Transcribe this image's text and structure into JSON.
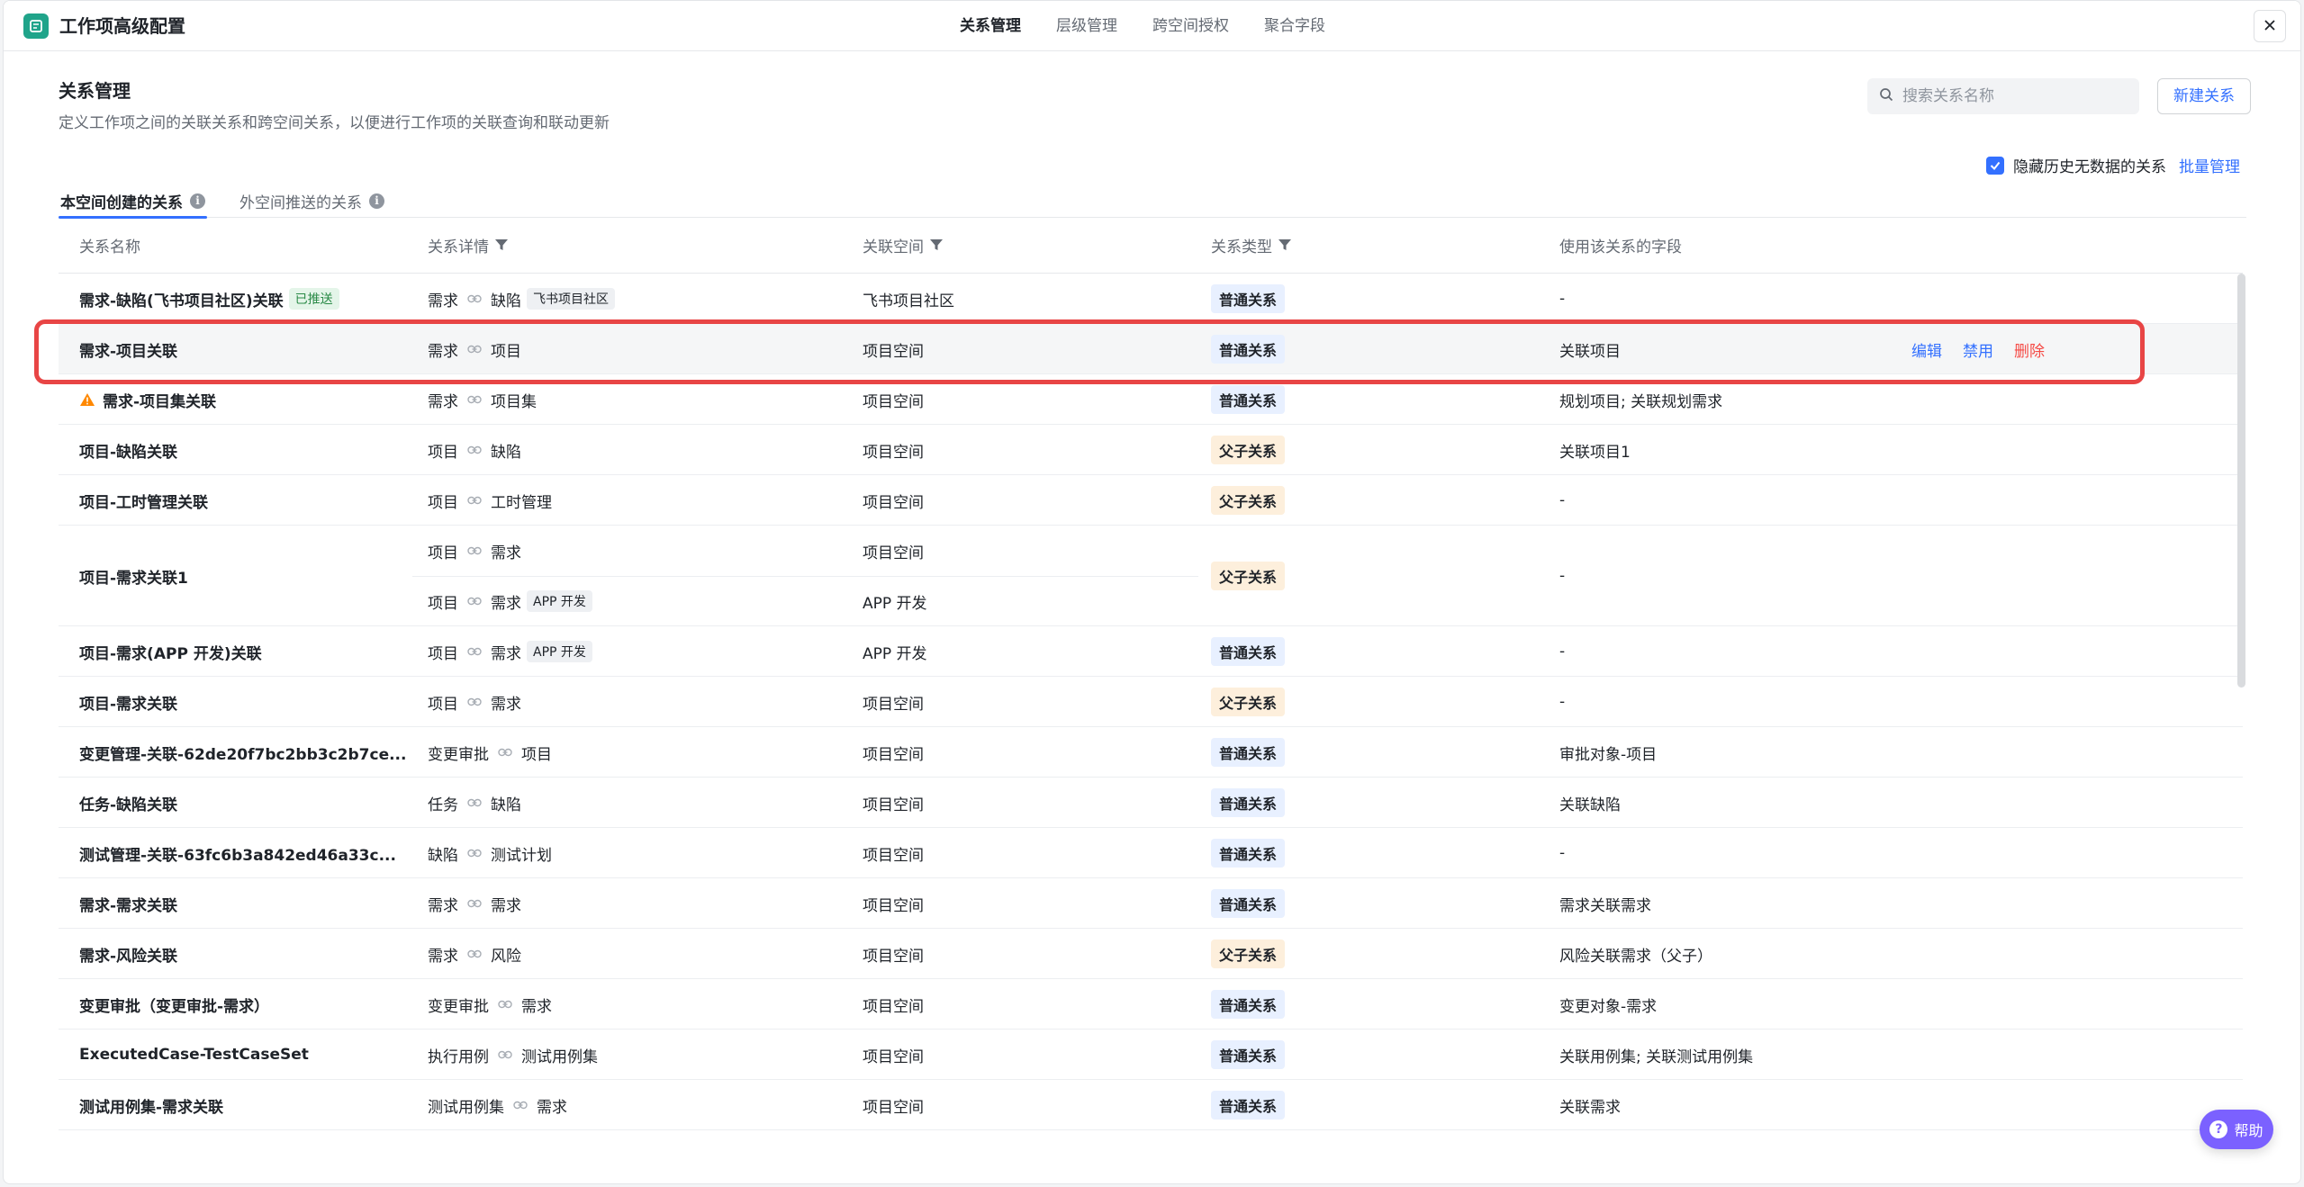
{
  "app": {
    "title": "工作项高级配置",
    "logo_icon": "workitem-config-icon"
  },
  "topnav": {
    "tabs": [
      {
        "label": "关系管理",
        "active": true
      },
      {
        "label": "层级管理",
        "active": false
      },
      {
        "label": "跨空间授权",
        "active": false
      },
      {
        "label": "聚合字段",
        "active": false
      }
    ]
  },
  "header": {
    "title": "关系管理",
    "description": "定义工作项之间的关联关系和跨空间关系，以便进行工作项的关联查询和联动更新",
    "search_placeholder": "搜索关系名称",
    "new_button": "新建关系",
    "hide_label": "隐藏历史无数据的关系",
    "hide_checked": true,
    "batch_label": "批量管理"
  },
  "subtabs": [
    {
      "label": "本空间创建的关系",
      "active": true
    },
    {
      "label": "外空间推送的关系",
      "active": false
    }
  ],
  "table": {
    "columns": [
      "关系名称",
      "关系详情",
      "关联空间",
      "关系类型",
      "使用该关系的字段"
    ],
    "rows": [
      {
        "name": "需求-缺陷(飞书项目社区)关联",
        "tag": "已推送",
        "from": "需求",
        "to": "缺陷",
        "to_tag": "飞书项目社区",
        "space": "飞书项目社区",
        "type": "普通关系",
        "field": "-"
      },
      {
        "name": "需求-项目关联",
        "from": "需求",
        "to": "项目",
        "space": "项目空间",
        "type": "普通关系",
        "field": "关联项目",
        "actions": [
          "编辑",
          "禁用",
          "删除"
        ]
      },
      {
        "name": "需求-项目集关联",
        "warning": true,
        "from": "需求",
        "to": "项目集",
        "space": "项目空间",
        "type": "普通关系",
        "field": "规划项目; 关联规划需求"
      },
      {
        "name": "项目-缺陷关联",
        "from": "项目",
        "to": "缺陷",
        "space": "项目空间",
        "type": "父子关系",
        "field": "关联项目1"
      },
      {
        "name": "项目-工时管理关联",
        "from": "项目",
        "to": "工时管理",
        "space": "项目空间",
        "type": "父子关系",
        "field": "-"
      },
      {
        "name": "项目-需求关联1",
        "from": "项目",
        "to": "需求",
        "space": "项目空间",
        "from2": "项目",
        "to2": "需求",
        "to2_tag": "APP 开发",
        "space2": "APP 开发",
        "type": "父子关系",
        "field": "-"
      },
      {
        "name": "项目-需求(APP 开发)关联",
        "from": "项目",
        "to": "需求",
        "to_tag": "APP 开发",
        "space": "APP 开发",
        "type": "普通关系",
        "field": "-"
      },
      {
        "name": "项目-需求关联",
        "from": "项目",
        "to": "需求",
        "space": "项目空间",
        "type": "父子关系",
        "field": "-"
      },
      {
        "name": "变更管理-关联-62de20f7bc2bb3c2b7ce...",
        "from": "变更审批",
        "to": "项目",
        "space": "项目空间",
        "type": "普通关系",
        "field": "审批对象-项目"
      },
      {
        "name": "任务-缺陷关联",
        "from": "任务",
        "to": "缺陷",
        "space": "项目空间",
        "type": "普通关系",
        "field": "关联缺陷"
      },
      {
        "name": "测试管理-关联-63fc6b3a842ed46a33c...",
        "from": "缺陷",
        "to": "测试计划",
        "space": "项目空间",
        "type": "普通关系",
        "field": "-"
      },
      {
        "name": "需求-需求关联",
        "from": "需求",
        "to": "需求",
        "space": "项目空间",
        "type": "普通关系",
        "field": "需求关联需求"
      },
      {
        "name": "需求-风险关联",
        "from": "需求",
        "to": "风险",
        "space": "项目空间",
        "type": "父子关系",
        "field": "风险关联需求（父子）"
      },
      {
        "name": "变更审批（变更审批-需求）",
        "from": "变更审批",
        "to": "需求",
        "space": "项目空间",
        "type": "普通关系",
        "field": "变更对象-需求"
      },
      {
        "name": "ExecutedCase-TestCaseSet",
        "from": "执行用例",
        "to": "测试用例集",
        "space": "项目空间",
        "type": "普通关系",
        "field": "关联用例集; 关联测试用例集"
      },
      {
        "name": "测试用例集-需求关联",
        "from": "测试用例集",
        "to": "需求",
        "space": "项目空间",
        "type": "普通关系",
        "field": "关联需求"
      }
    ]
  },
  "help": {
    "label": "帮助"
  },
  "colors": {
    "accent": "#3370ff",
    "danger": "#f54a45",
    "brand": "#20a48a",
    "highlight": "#e84545"
  }
}
